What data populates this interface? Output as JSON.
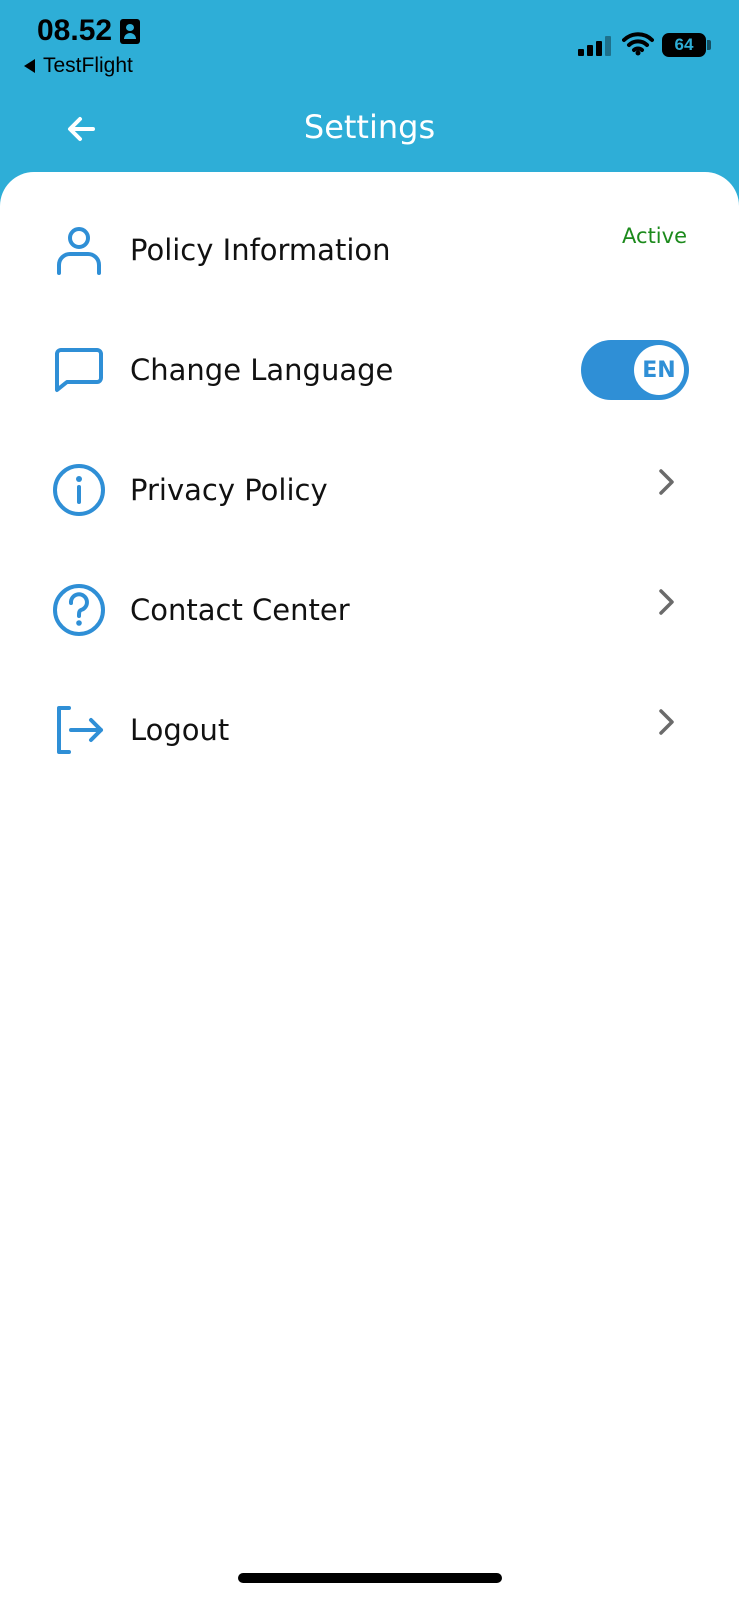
{
  "status_bar": {
    "time": "08.52",
    "back_app": "TestFlight",
    "battery": "64",
    "icons": [
      "id-card-icon",
      "cellular-signal-icon",
      "wifi-icon",
      "battery-icon"
    ]
  },
  "header": {
    "title": "Settings",
    "back_icon": "arrow-left-icon"
  },
  "colors": {
    "header_bg": "#2eaed7",
    "accent": "#2f8fd6",
    "active_green": "#1c8a1c",
    "chevron": "#6b6b6b"
  },
  "settings": {
    "policy_information": {
      "label": "Policy Information",
      "status": "Active",
      "icon": "person-icon"
    },
    "change_language": {
      "label": "Change Language",
      "toggle_value": "EN",
      "icon": "chat-bubble-icon"
    },
    "privacy_policy": {
      "label": "Privacy Policy",
      "icon": "info-circle-icon"
    },
    "contact_center": {
      "label": "Contact Center",
      "icon": "question-circle-icon"
    },
    "logout": {
      "label": "Logout",
      "icon": "logout-arrow-icon"
    }
  }
}
